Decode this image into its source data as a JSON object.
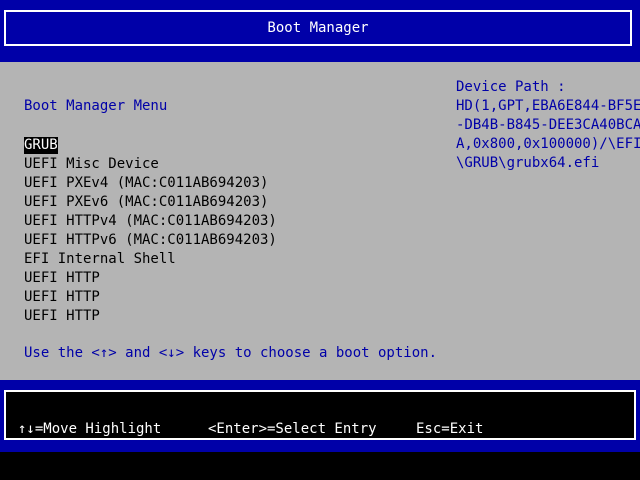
{
  "header": {
    "title": "Boot Manager"
  },
  "menu": {
    "title": "Boot Manager Menu",
    "items": [
      {
        "label": "GRUB",
        "selected": true
      },
      {
        "label": "UEFI Misc Device",
        "selected": false
      },
      {
        "label": "UEFI PXEv4 (MAC:C011AB694203)",
        "selected": false
      },
      {
        "label": "UEFI PXEv6 (MAC:C011AB694203)",
        "selected": false
      },
      {
        "label": "UEFI HTTPv4 (MAC:C011AB694203)",
        "selected": false
      },
      {
        "label": "UEFI HTTPv6 (MAC:C011AB694203)",
        "selected": false
      },
      {
        "label": "EFI Internal Shell",
        "selected": false
      },
      {
        "label": "UEFI HTTP",
        "selected": false
      },
      {
        "label": "UEFI HTTP",
        "selected": false
      },
      {
        "label": "UEFI HTTP",
        "selected": false
      }
    ],
    "help_text": "Use the <↑> and <↓> keys to choose a boot option."
  },
  "device_path": {
    "lines": [
      "Device Path :",
      "HD(1,GPT,EBA6E844-BF5E",
      "-DB4B-B845-DEE3CA40BCA",
      "A,0x800,0x100000)/\\EFI",
      "\\GRUB\\grubx64.efi"
    ]
  },
  "footer": {
    "move": "↑↓=Move Highlight",
    "select": "<Enter>=Select Entry",
    "exit": "Esc=Exit"
  },
  "colors": {
    "background_blue": "#0000a8",
    "panel_gray": "#b4b4b4",
    "text_white": "#ffffff",
    "text_black": "#000000"
  }
}
